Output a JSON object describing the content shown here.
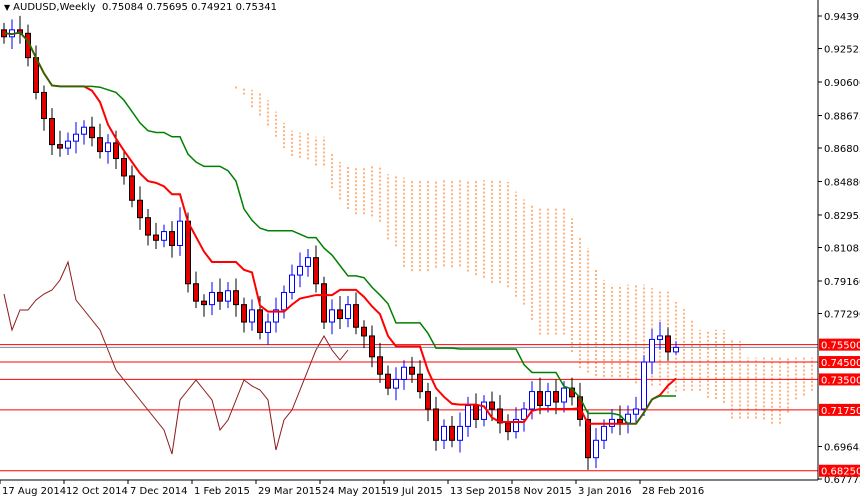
{
  "title": {
    "symbol": "AUDUSD,Weekly",
    "ohlc": "0.75084 0.75695 0.74921 0.75341"
  },
  "colors": {
    "up": "#0000ff",
    "down": "#e00000",
    "tenkan": "#ff0000",
    "kijun": "#008000",
    "cloud": "#ff6600",
    "oscillator": "#8b1a1a",
    "levels": "#ff0000"
  },
  "chart_data": {
    "type": "candlestick",
    "title": "AUDUSD,Weekly",
    "x_tick_labels": [
      "17 Aug 2014",
      "12 Oct 2014",
      "7 Dec 2014",
      "1 Feb 2015",
      "29 Mar 2015",
      "24 May 2015",
      "19 Jul 2015",
      "13 Sep 2015",
      "8 Nov 2015",
      "3 Jan 2016",
      "28 Feb 2016"
    ],
    "y_tick_labels": [
      "0.94395",
      "0.92525",
      "0.90600",
      "0.88675",
      "0.86805",
      "0.84880",
      "0.82955",
      "0.81085",
      "0.79160",
      "0.77290",
      "0.69645",
      "0.67775"
    ],
    "ylim": [
      0.67775,
      0.94395
    ],
    "last_bar": {
      "open": 0.75084,
      "high": 0.75695,
      "low": 0.74921,
      "close": 0.75341
    },
    "closes": [
      0.932,
      0.936,
      0.934,
      0.92,
      0.9,
      0.885,
      0.87,
      0.868,
      0.872,
      0.876,
      0.88,
      0.874,
      0.866,
      0.871,
      0.862,
      0.852,
      0.838,
      0.828,
      0.818,
      0.815,
      0.82,
      0.812,
      0.826,
      0.79,
      0.78,
      0.778,
      0.785,
      0.78,
      0.786,
      0.778,
      0.768,
      0.775,
      0.762,
      0.768,
      0.775,
      0.785,
      0.795,
      0.8,
      0.805,
      0.79,
      0.768,
      0.775,
      0.77,
      0.778,
      0.765,
      0.76,
      0.748,
      0.738,
      0.73,
      0.735,
      0.742,
      0.738,
      0.728,
      0.718,
      0.7,
      0.708,
      0.7,
      0.708,
      0.72,
      0.712,
      0.722,
      0.718,
      0.71,
      0.705,
      0.712,
      0.718,
      0.728,
      0.72,
      0.728,
      0.722,
      0.73,
      0.725,
      0.712,
      0.69,
      0.7,
      0.708,
      0.712,
      0.71,
      0.715,
      0.718,
      0.745,
      0.758,
      0.76,
      0.75084,
      0.75341
    ],
    "oscillator": [
      88,
      70,
      80,
      80,
      85,
      88,
      90,
      95,
      104,
      85,
      80,
      75,
      70,
      60,
      50,
      45,
      40,
      35,
      30,
      25,
      20,
      8,
      35,
      40,
      45,
      40,
      35,
      20,
      25,
      35,
      45,
      42,
      40,
      35,
      10,
      25,
      30,
      40,
      50,
      60,
      67,
      60,
      55,
      60
    ],
    "levels": [
      {
        "value": 0.755,
        "label": "0.75500"
      },
      {
        "value": 0.745,
        "label": "0.74500"
      },
      {
        "value": 0.735,
        "label": "0.73500"
      },
      {
        "value": 0.7175,
        "label": "0.71750"
      },
      {
        "value": 0.6825,
        "label": "0.68250"
      }
    ],
    "series": [
      "Candles",
      "Tenkan-sen",
      "Kijun-sen",
      "Ichimoku cloud",
      "Oscillator"
    ]
  }
}
